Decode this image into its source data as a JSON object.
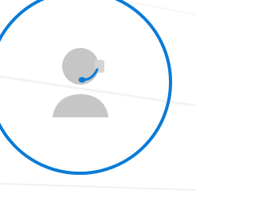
{
  "accent_color": "#0a7bd6",
  "avatar_icon": "support-agent-headset-icon",
  "avatar_fill_color": "#c6c6c6"
}
